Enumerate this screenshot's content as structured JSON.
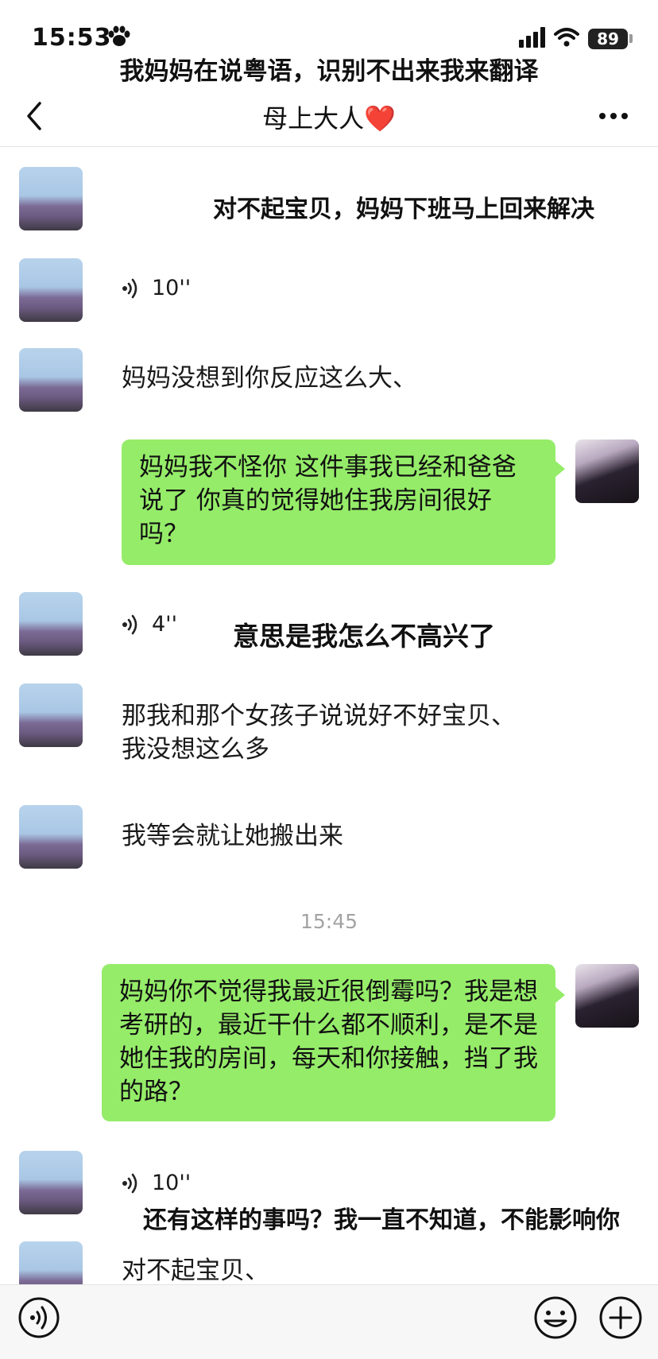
{
  "status_bar": {
    "time": "15:53",
    "battery": "89"
  },
  "overlay_caption": "我妈妈在说粤语，识别不出来我来翻译",
  "nav": {
    "title": "母上大人",
    "heart": "❤️"
  },
  "messages": {
    "m1_overlay": "对不起宝贝，妈妈下班马上回来解决",
    "m2_voice_duration": "10''",
    "m3_text": "妈妈没想到你反应这么大、",
    "m4_text": "妈妈我不怪你 这件事我已经和爸爸说了 你真的觉得她住我房间很好吗？",
    "m5_voice_duration": "4''",
    "m5_overlay": "意思是我怎么不高兴了",
    "m6_line1": "那我和那个女孩子说说好不好宝贝、",
    "m6_line2": "我没想这么多",
    "m7_text": "我等会就让她搬出来",
    "timestamp": "15:45",
    "m8_text": "妈妈你不觉得我最近很倒霉吗？我是想考研的，最近干什么都不顺利，是不是她住我的房间，每天和你接触，挡了我的路？",
    "m9_voice_duration": "10''",
    "m9_overlay": "还有这样的事吗？我一直不知道，不能影响你",
    "m10_text": "对不起宝贝、"
  },
  "colors": {
    "bubble_green": "#95ec69",
    "timestamp_grey": "#a3a3a3",
    "heart_red": "#e0242e"
  },
  "icons": [
    "paw-icon",
    "signal-icon",
    "wifi-icon",
    "back-chevron-icon",
    "more-icon",
    "voice-wave-icon",
    "emoji-icon",
    "plus-icon"
  ]
}
